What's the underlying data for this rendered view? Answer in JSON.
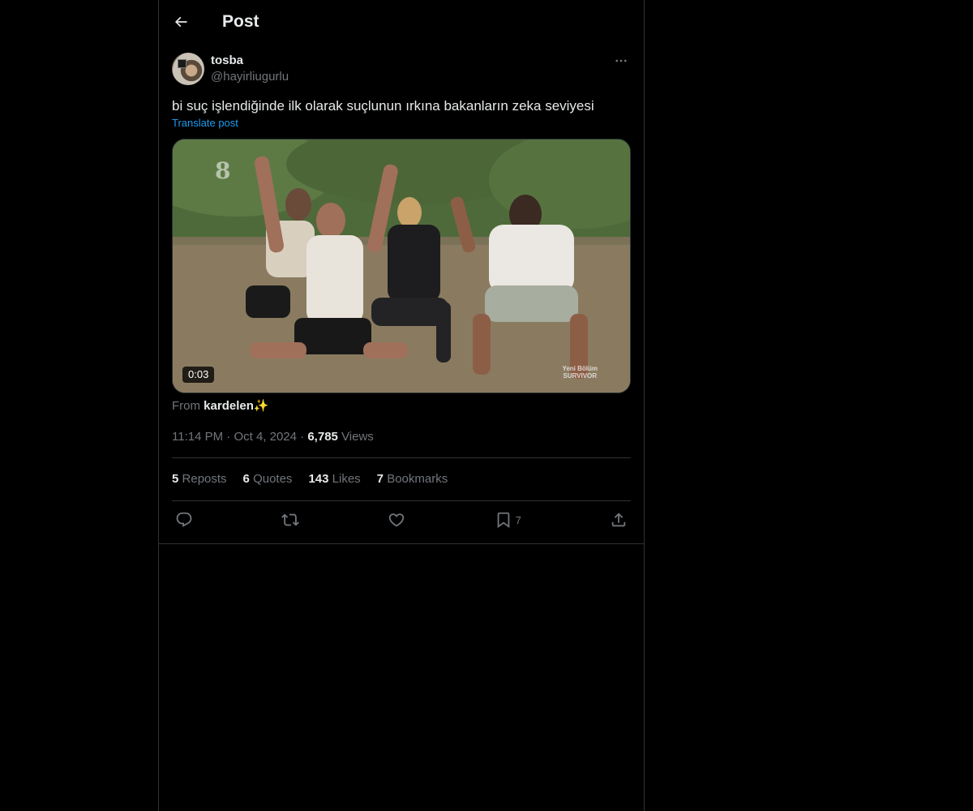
{
  "header": {
    "title": "Post",
    "back_icon": "arrow-left-icon"
  },
  "post": {
    "author": {
      "display_name": "tosba",
      "handle": "@hayirliugurlu"
    },
    "text": "bi suç işlendiğinde ilk olarak suçlunun ırkına bakanların zeka seviyesi",
    "translate_label": "Translate post",
    "video": {
      "duration": "0:03",
      "overlay_number": "8",
      "watermark_line1": "Yeni Bölüm",
      "watermark_line2": "SURVIVOR"
    },
    "from": {
      "prefix": "From",
      "source": "kardelen✨"
    },
    "meta": {
      "time": "11:14 PM",
      "date": "Oct 4, 2024",
      "views_count": "6,785",
      "views_label": "Views"
    },
    "stats": {
      "reposts_count": "5",
      "reposts_label": "Reposts",
      "quotes_count": "6",
      "quotes_label": "Quotes",
      "likes_count": "143",
      "likes_label": "Likes",
      "bookmarks_count": "7",
      "bookmarks_label": "Bookmarks"
    },
    "actions": {
      "bookmark_count": "7"
    }
  },
  "colors": {
    "background": "#000000",
    "text_primary": "#e7e9ea",
    "text_secondary": "#71767b",
    "link": "#1d9bf0",
    "border": "#2f3336"
  }
}
